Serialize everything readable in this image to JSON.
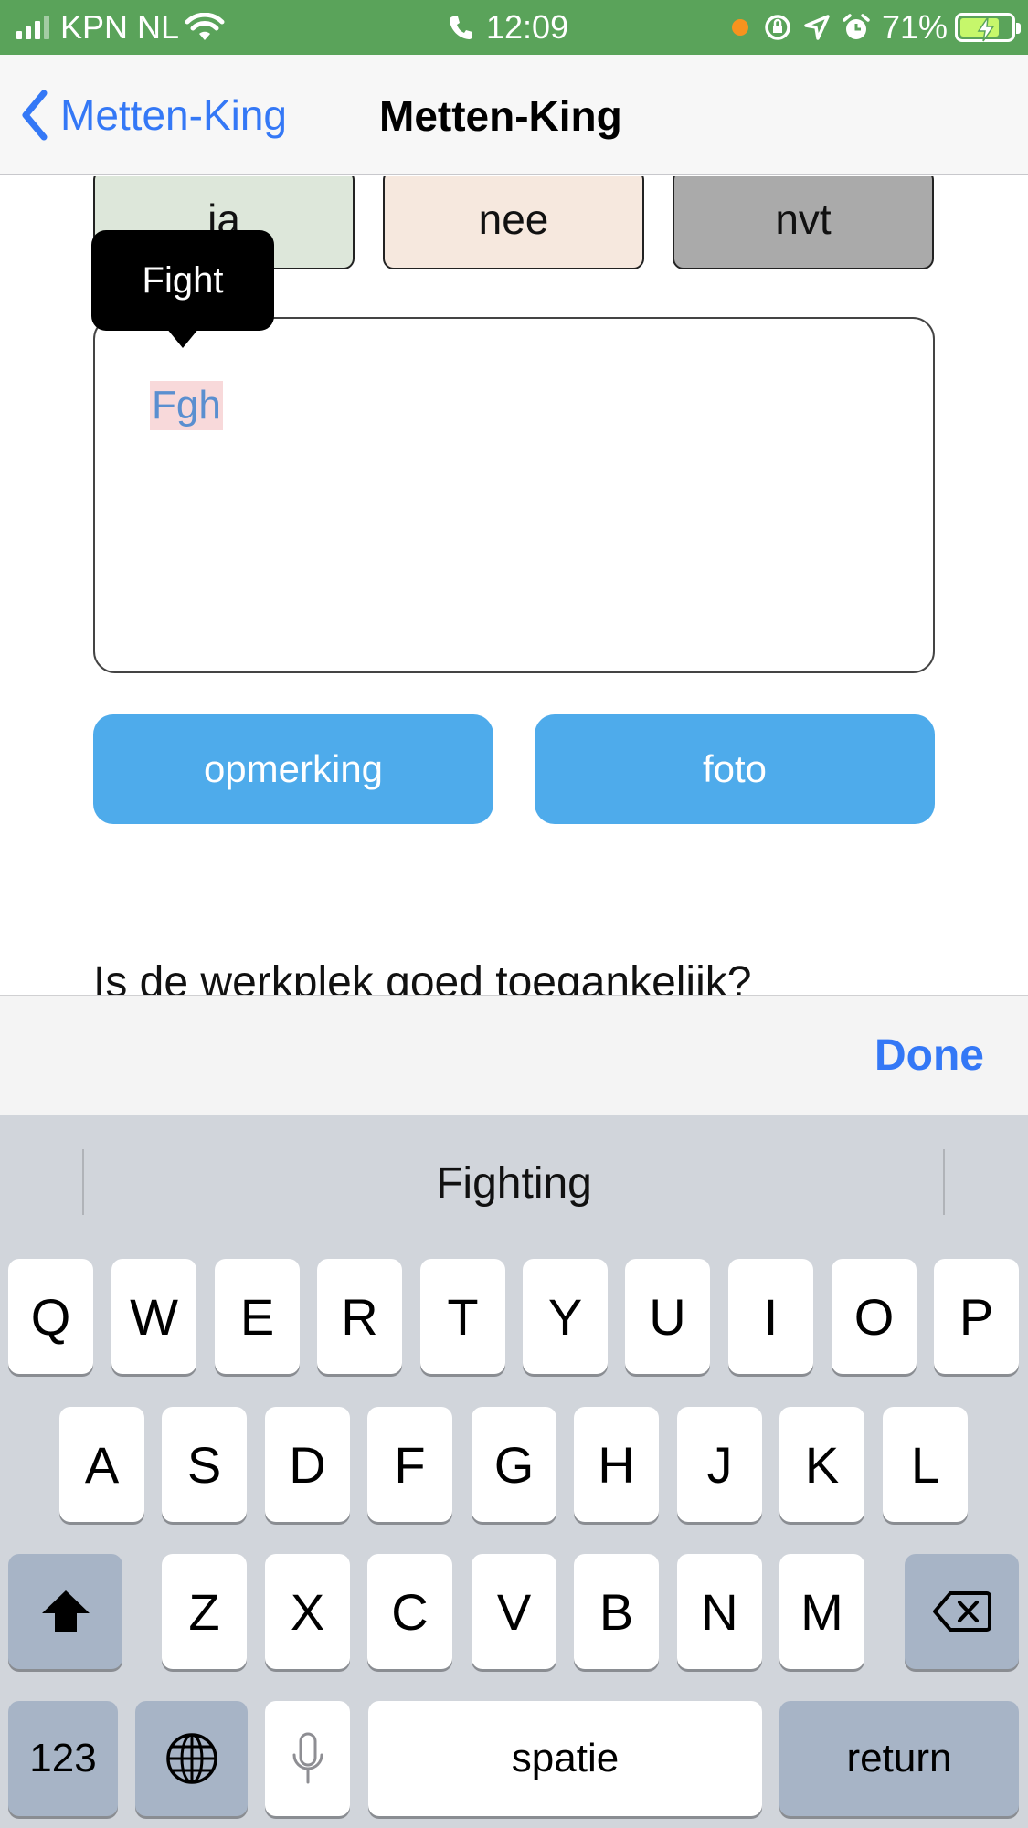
{
  "status_bar": {
    "carrier": "KPN NL",
    "time": "12:09",
    "battery": "71%"
  },
  "nav": {
    "back_label": "Metten-King",
    "title": "Metten-King"
  },
  "form": {
    "choices": [
      "ja",
      "nee",
      "nvt"
    ],
    "textarea_value": "Fgh",
    "autocorrect_tooltip": "Fight",
    "opmerking_label": "opmerking",
    "foto_label": "foto",
    "next_question": "Is de werkplek goed toegankelijk?"
  },
  "toolbar": {
    "done_label": "Done"
  },
  "keyboard": {
    "suggestion": "Fighting",
    "row1": [
      "Q",
      "W",
      "E",
      "R",
      "T",
      "Y",
      "U",
      "I",
      "O",
      "P"
    ],
    "row2": [
      "A",
      "S",
      "D",
      "F",
      "G",
      "H",
      "J",
      "K",
      "L"
    ],
    "row3": [
      "Z",
      "X",
      "C",
      "V",
      "B",
      "N",
      "M"
    ],
    "numbers_label": "123",
    "space_label": "spatie",
    "return_label": "return"
  },
  "colors": {
    "status_bar": "#5aa35a",
    "accent_blue": "#3478f6",
    "button_blue": "#4eabeb"
  }
}
